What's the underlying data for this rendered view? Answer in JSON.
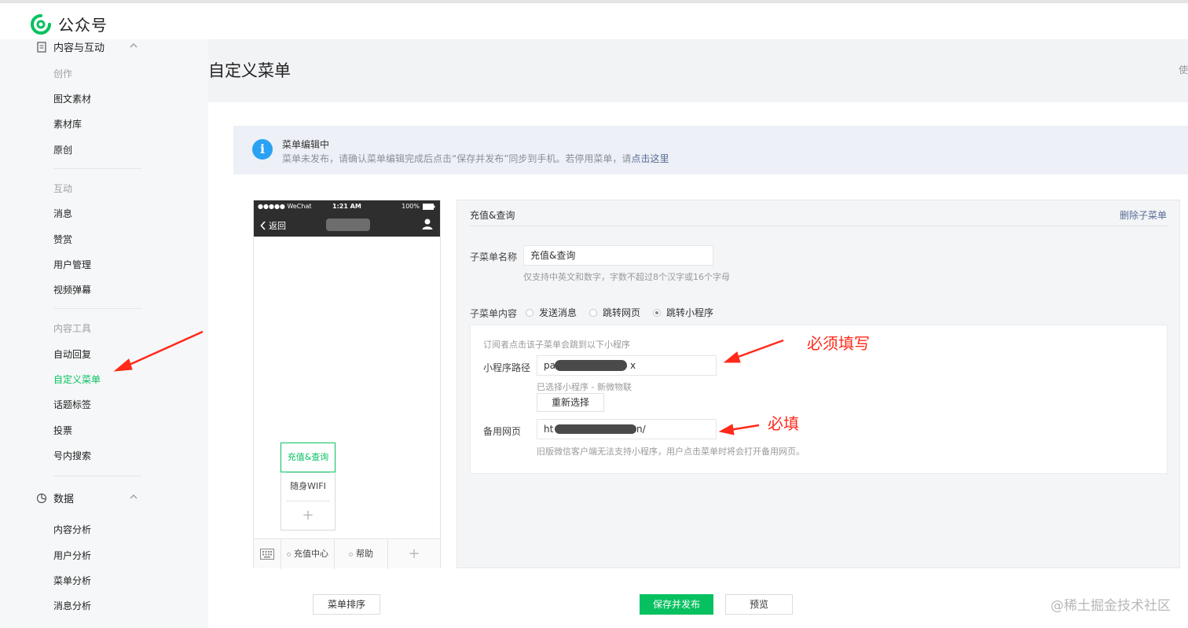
{
  "app": {
    "name": "公众号",
    "brand_color": "#07c160"
  },
  "sidebar": {
    "groups": [
      {
        "label": "内容与互动",
        "icon": "document-icon"
      },
      {
        "label": "数据",
        "icon": "pie-chart-icon"
      }
    ],
    "sections": [
      {
        "heading": "创作",
        "items": [
          "图文素材",
          "素材库",
          "原创"
        ]
      },
      {
        "heading": "互动",
        "items": [
          "消息",
          "赞赏",
          "用户管理",
          "视频弹幕"
        ]
      },
      {
        "heading": "内容工具",
        "items": [
          "自动回复",
          "自定义菜单",
          "话题标签",
          "投票",
          "号内搜索"
        ]
      }
    ],
    "data_items": [
      "内容分析",
      "用户分析",
      "菜单分析",
      "消息分析"
    ],
    "active_item": "自定义菜单"
  },
  "page": {
    "title": "自定义菜单",
    "right_hint": "使"
  },
  "notice": {
    "title": "菜单编辑中",
    "desc": "菜单未发布，请确认菜单编辑完成后点击“保存并发布”同步到手机。若停用菜单，请",
    "link": "点击这里"
  },
  "phone": {
    "carrier": "●●●●● WeChat",
    "time": "1:21 AM",
    "battery": "100%",
    "back_label": "返回",
    "submenu": [
      "充值&查询",
      "随身WIFI",
      "+"
    ],
    "bottom_menu": [
      "充值中心",
      "帮助",
      "+"
    ]
  },
  "editor": {
    "title": "充值&查询",
    "delete_label": "删除子菜单",
    "name_label": "子菜单名称",
    "name_value": "充值&查询",
    "name_tip": "仅支持中英文和数字，字数不超过8个汉字或16个字母",
    "content_label": "子菜单内容",
    "content_options": [
      "发送消息",
      "跳转网页",
      "跳转小程序"
    ],
    "content_selected": "跳转小程序",
    "mp_intro": "订阅者点击该子菜单会跳到以下小程序",
    "mp_path_label": "小程序路径",
    "mp_path_prefix": "pa",
    "mp_path_suffix": "x",
    "mp_selected": "已选择小程序 - 新微物联",
    "reselect_label": "重新选择",
    "backup_label": "备用网页",
    "backup_prefix": "ht",
    "backup_suffix": "n/",
    "backup_tip": "旧版微信客户端无法支持小程序，用户点击菜单时将会打开备用网页。"
  },
  "footer": {
    "sort_label": "菜单排序",
    "save_label": "保存并发布",
    "preview_label": "预览"
  },
  "annotations": {
    "required_1": "必须填写",
    "required_2": "必填",
    "color": "#ff2a1a"
  },
  "watermark": "@稀土掘金技术社区"
}
